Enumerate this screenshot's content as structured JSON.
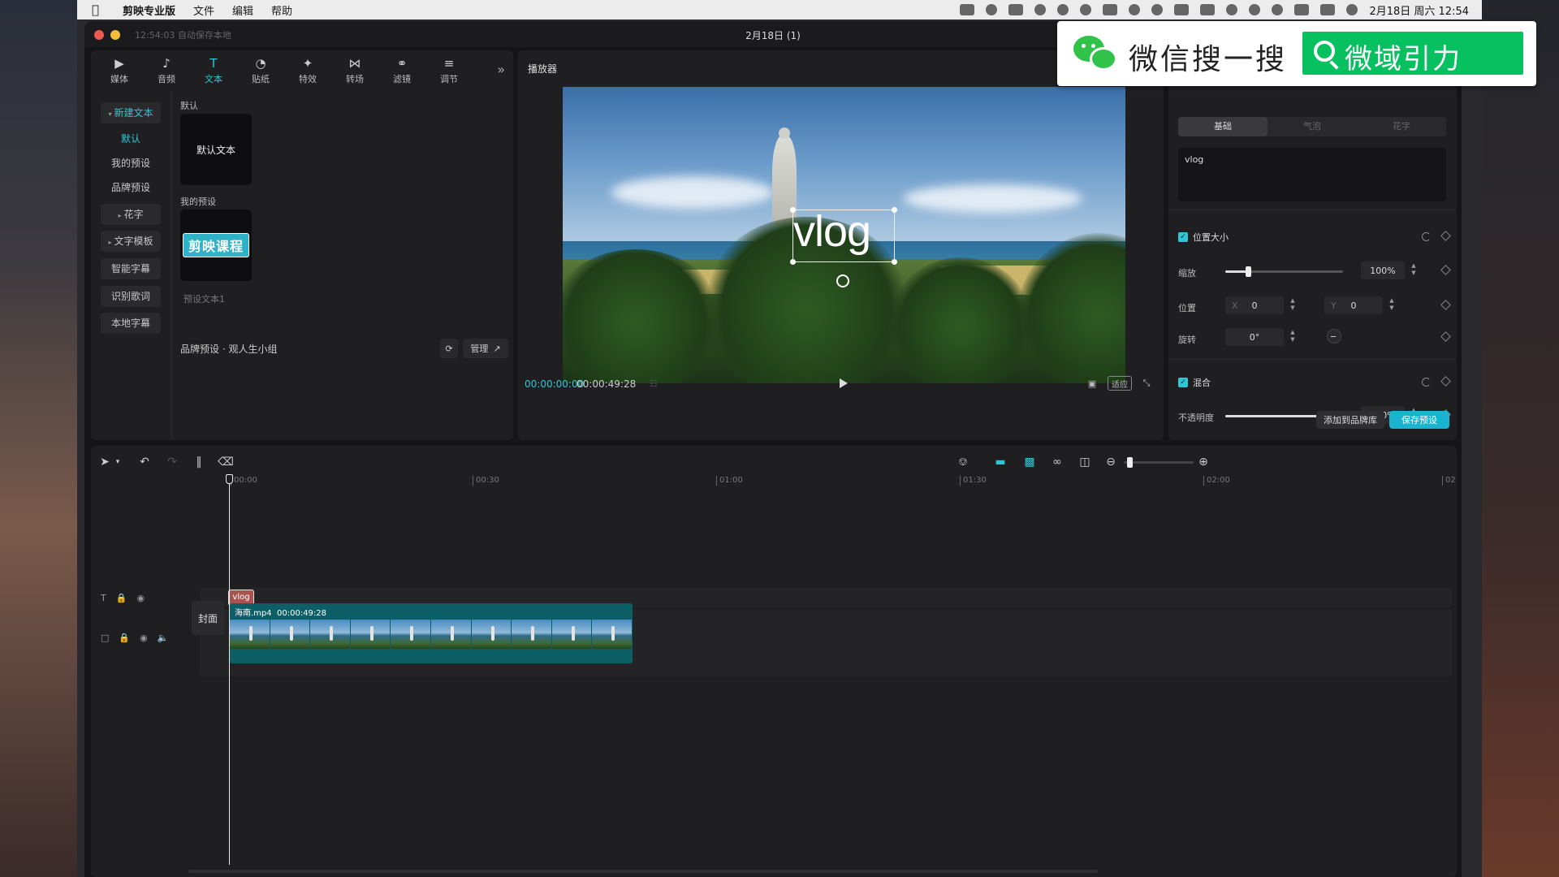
{
  "menubar": {
    "app_name": "剪映专业版",
    "menus": [
      "文件",
      "编辑",
      "帮助"
    ],
    "clock": "2月18日 周六 12:54"
  },
  "window": {
    "autosave": "12:54:03 自动保存本地",
    "title": "2月18日 (1)"
  },
  "toolbar_tabs": [
    {
      "label": "媒体",
      "icon": "media-icon"
    },
    {
      "label": "音频",
      "icon": "audio-icon"
    },
    {
      "label": "文本",
      "icon": "text-icon"
    },
    {
      "label": "贴纸",
      "icon": "sticker-icon"
    },
    {
      "label": "特效",
      "icon": "effects-icon"
    },
    {
      "label": "转场",
      "icon": "transition-icon"
    },
    {
      "label": "滤镜",
      "icon": "filter-icon"
    },
    {
      "label": "调节",
      "icon": "adjust-icon"
    }
  ],
  "side_nav": {
    "new_text": "新建文本",
    "default": "默认",
    "my_presets": "我的预设",
    "brand_presets": "品牌预设",
    "fancy": "花字",
    "text_template": "文字模板",
    "smart_subtitle": "智能字幕",
    "lyrics": "识别歌词",
    "local_subtitle": "本地字幕"
  },
  "content": {
    "default_heading": "默认",
    "default_card": "默认文本",
    "my_presets_heading": "我的预设",
    "preset_badge": "剪映课程",
    "preset_name": "预设文本1",
    "brand_line": "品牌预设 · 观人生小组",
    "manage_btn": "管理"
  },
  "player": {
    "title": "播放器",
    "overlay_text": "vlog",
    "time_current": "00:00:00:00",
    "time_total": "00:00:49:28",
    "fit_btn": "适应"
  },
  "inspector": {
    "seg_tabs": [
      "基础",
      "气泡",
      "花字"
    ],
    "text_value": "vlog",
    "pos_size_label": "位置大小",
    "scale_label": "缩放",
    "scale_value": "100%",
    "scale_fraction": 0.2,
    "position_label": "位置",
    "x_prefix": "X",
    "x_value": "0",
    "y_prefix": "Y",
    "y_value": "0",
    "rotate_label": "旋转",
    "rotate_value": "0°",
    "blend_label": "混合",
    "opacity_label": "不透明度",
    "opacity_value": "100%",
    "opacity_fraction": 1.0,
    "add_brand_btn": "添加到品牌库",
    "save_preset_btn": "保存预设"
  },
  "timeline": {
    "ticks": [
      "00:00",
      "00:30",
      "01:00",
      "01:30",
      "02:00",
      "02"
    ],
    "text_clip": "vlog",
    "cover_btn": "封面",
    "video_clip_name": "海南.mp4",
    "video_clip_duration": "00:00:49:28"
  },
  "overlay": {
    "wechat_text": "微信搜一搜",
    "search_text": "微域引力"
  },
  "colors": {
    "accent": "#2ec6d6",
    "primary_button": "#19b4cf",
    "text_clip": "#a8544e",
    "video_clip": "#0d5f67",
    "wechat_green": "#07c160"
  }
}
